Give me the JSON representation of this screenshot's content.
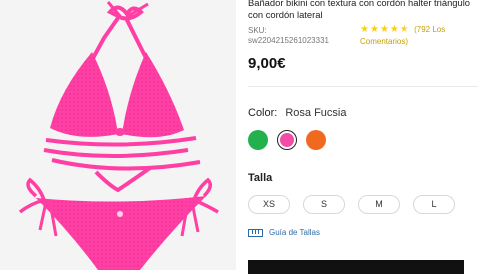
{
  "product": {
    "title": "Bañador bikini con textura con cordón halter triángulo con cordón lateral",
    "sku_label": "SKU:",
    "sku_value": "sw2204215261023331",
    "rating": {
      "stars": 4.5,
      "reviews_text": "(792 Los Comentarios)"
    },
    "price": "9,00€"
  },
  "color": {
    "label": "Color:",
    "selected": "Rosa Fucsia",
    "swatches": [
      {
        "name": "green",
        "hex": "#22b14c"
      },
      {
        "name": "fuchsia",
        "hex": "#f54ba8"
      },
      {
        "name": "orange",
        "hex": "#ef6a1e"
      }
    ]
  },
  "size": {
    "label": "Talla",
    "options": [
      "XS",
      "S",
      "M",
      "L"
    ],
    "guide": "Guía de Tallas"
  },
  "theme": {
    "accent_pink": "#ff3fa3",
    "star": "#facf19",
    "link": "#2b6ca8"
  }
}
